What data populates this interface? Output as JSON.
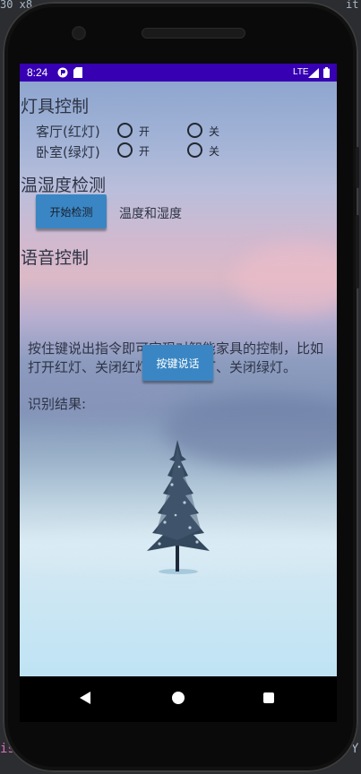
{
  "editor": {
    "top_left": "30 x8",
    "top_right": "it:",
    "bottom_left": "is)",
    "bottom_right": "Y"
  },
  "status_bar": {
    "time": "8:24",
    "network": "LTE"
  },
  "lights": {
    "title": "灯具控制",
    "rows": [
      {
        "label": "客厅(红灯)",
        "on": "开",
        "off": "关"
      },
      {
        "label": "卧室(绿灯)",
        "on": "开",
        "off": "关"
      }
    ]
  },
  "sensor": {
    "title": "温湿度检测",
    "button": "开始检测",
    "result": "温度和湿度"
  },
  "voice": {
    "title": "语音控制",
    "description": "按住键说出指令即可实现对智能家具的控制，比如打开红灯、关闭红灯、打开绿灯、关闭绿灯。",
    "button": "按键说话",
    "result_label": "识别结果:"
  },
  "colors": {
    "status_bar": "#3700b3",
    "button": "#3a86c4"
  },
  "nav": [
    "back-icon",
    "home-icon",
    "recents-icon"
  ]
}
